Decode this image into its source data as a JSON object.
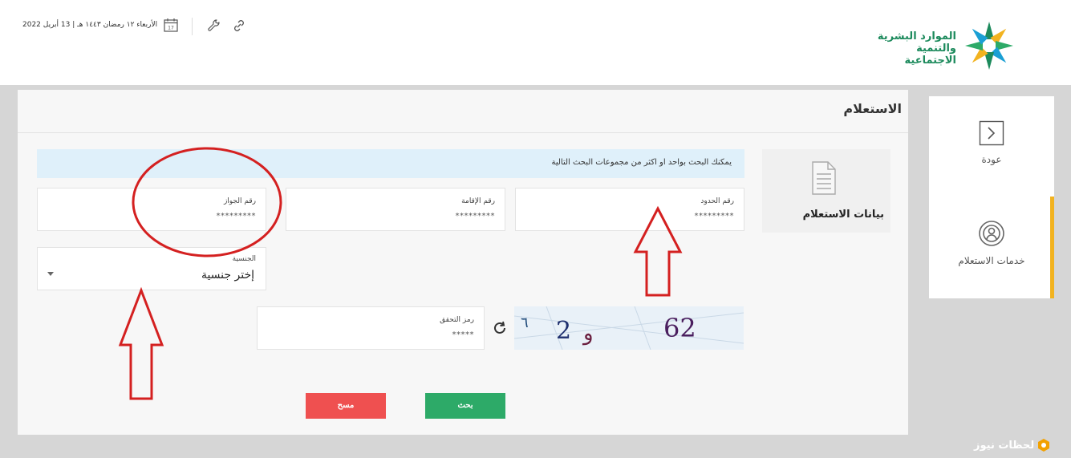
{
  "header": {
    "logo_line1": "الموارد البشرية",
    "logo_line2": "والتنمية الاجتماعية",
    "date": "الأربعاء ١٢ رمضان ١٤٤٣ هـ | 13 أبريل 2022",
    "calendar_day": "17"
  },
  "page": {
    "title": "الاستعلام",
    "side_section": "بيانات الاستعلام",
    "info": "يمكنك البحث بواحد او اكثر من مجموعات البحث التالية"
  },
  "fields": {
    "border_label": "رقم الحدود",
    "border_placeholder": "*********",
    "iqama_label": "رقم الإقامة",
    "iqama_placeholder": "*********",
    "passport_label": "رقم الجواز",
    "passport_placeholder": "*********",
    "nationality_label": "الجنسية",
    "nationality_value": "إختر جنسية",
    "captcha_label": "رمز التحقق",
    "captcha_placeholder": "*****"
  },
  "captcha": {
    "text": "62   2و   ٦"
  },
  "buttons": {
    "search": "بحث",
    "clear": "مسح"
  },
  "sidebar": {
    "back": "عودة",
    "services": "خدمات الاستعلام"
  },
  "watermark": {
    "text": "لحظات نيوز"
  },
  "colors": {
    "brand_green": "#1c8a5c",
    "search_button": "#2daa68",
    "clear_button": "#ef5050",
    "accent": "#f2b320",
    "annotation": "#d42020"
  }
}
